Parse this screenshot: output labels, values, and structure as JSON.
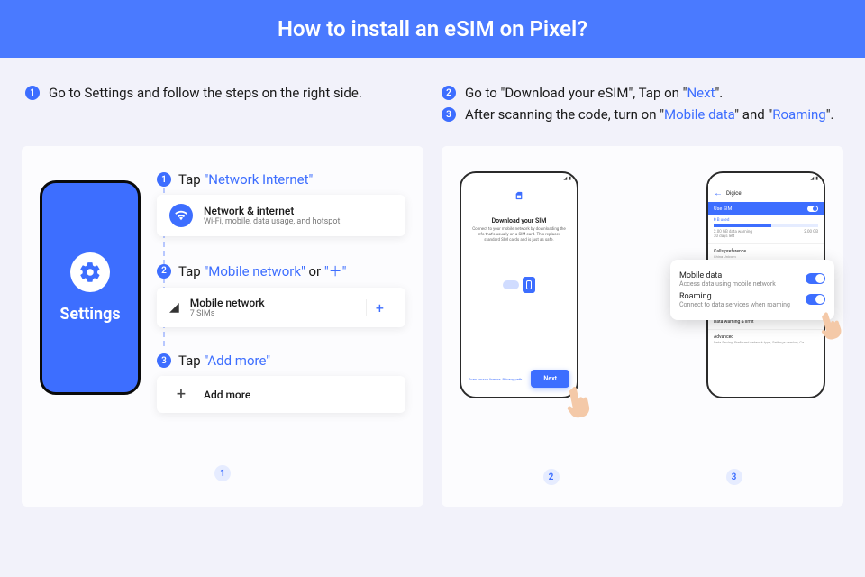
{
  "header": {
    "title": "How to install an eSIM on Pixel?"
  },
  "intro": {
    "left": {
      "num": "1",
      "text": "Go to Settings and follow the steps on the right side."
    },
    "right": [
      {
        "num": "2",
        "pre": "Go to \"Download your eSIM\", Tap on \"",
        "hl": "Next",
        "post": "\"."
      },
      {
        "num": "3",
        "pre": "After scanning the code, turn on \"",
        "hl1": "Mobile data",
        "mid": "\" and \"",
        "hl2": "Roaming",
        "post": "\"."
      }
    ]
  },
  "panel1": {
    "phone_label": "Settings",
    "steps": [
      {
        "num": "1",
        "tap": "Tap ",
        "hl": "\"Network Internet\"",
        "card": {
          "title": "Network & internet",
          "sub": "Wi-Fi, mobile, data usage, and hotspot"
        }
      },
      {
        "num": "2",
        "tap": "Tap ",
        "hl": "\"Mobile network\"",
        "or": " or ",
        "hl2": "\"＋\"",
        "card": {
          "title": "Mobile network",
          "sub": "7 SIMs",
          "plus": "+"
        }
      },
      {
        "num": "3",
        "tap": "Tap ",
        "hl": "\"Add more\"",
        "card": {
          "title": "Add more"
        }
      }
    ],
    "badge": "1"
  },
  "panel2": {
    "mock1": {
      "title": "Download your SIM",
      "desc": "Connect to your mobile network by downloading the info that's usually on a SIM card. This replaces standard SIM cards and is just as safe.",
      "scan": "Scan source license. Privacy path",
      "next": "Next"
    },
    "mock2": {
      "carrier": "Digicel",
      "use_sim": "Use SIM",
      "used_label": "B used",
      "used_value": "0",
      "warn": "2.00 GB data warning",
      "days": "30 days left",
      "limit": "2.00 GB",
      "calls_pref": "Calls preference",
      "calls_sub": "China Unicom",
      "data_warn": "Data warning & limit",
      "advanced": "Advanced",
      "advanced_sub": "Data Saving, Preferred network type, Settings version, Ca..."
    },
    "popup": {
      "r1t": "Mobile data",
      "r1s": "Access data using mobile network",
      "r2t": "Roaming",
      "r2s": "Connect to data services when roaming"
    },
    "badges": [
      "2",
      "3"
    ]
  }
}
